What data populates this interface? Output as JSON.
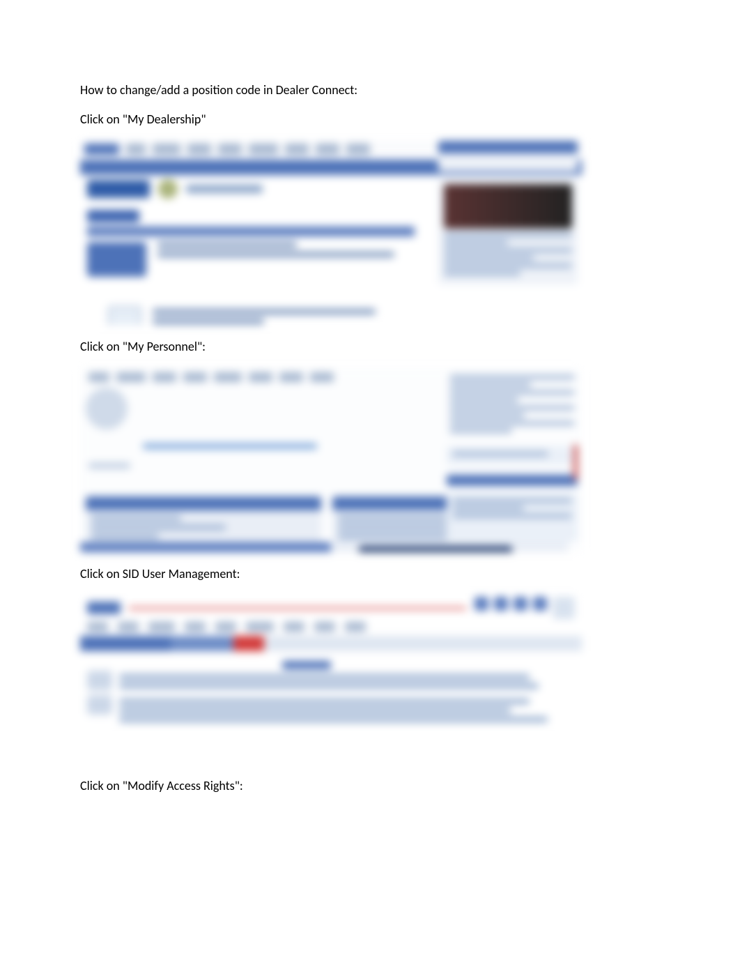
{
  "doc": {
    "title": "How to change/add a position code in Dealer Connect:",
    "step1": "Click on \"My Dealership\"",
    "step2": "Click on \"My Personnel\":",
    "step3": "Click on SID User Management:",
    "step4": "Click on \"Modify Access Rights\":"
  }
}
